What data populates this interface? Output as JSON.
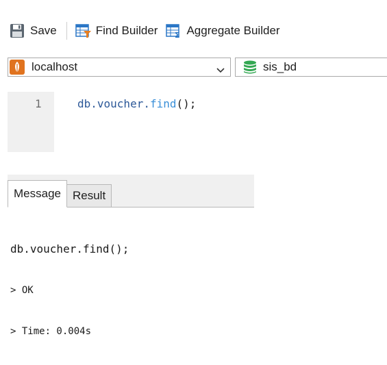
{
  "toolbar": {
    "save_label": "Save",
    "find_builder_label": "Find Builder",
    "aggregate_builder_label": "Aggregate Builder"
  },
  "connection": {
    "selected": "localhost",
    "database": "sis_bd"
  },
  "editor": {
    "line_number": "1",
    "code": {
      "obj": "db.voucher.",
      "fn": "find",
      "tail": "();"
    }
  },
  "results": {
    "tabs": [
      "Message",
      "Result"
    ],
    "active_tab": "Message",
    "output": {
      "query": "db.voucher.find();",
      "status": "> OK",
      "time": "> Time: 0.004s"
    }
  },
  "colors": {
    "mongo_orange": "#e0731f",
    "db_green": "#34a853",
    "builder_blue": "#2a76c6",
    "code_blue": "#2b5797",
    "code_fn": "#3a8fd8"
  },
  "icons": {
    "save": "floppy-disk-icon",
    "find_builder": "table-filter-icon",
    "aggregate_builder": "table-sigma-icon",
    "connection": "mongodb-leaf-icon",
    "dropdown": "chevron-down-icon",
    "database": "database-stack-icon"
  }
}
